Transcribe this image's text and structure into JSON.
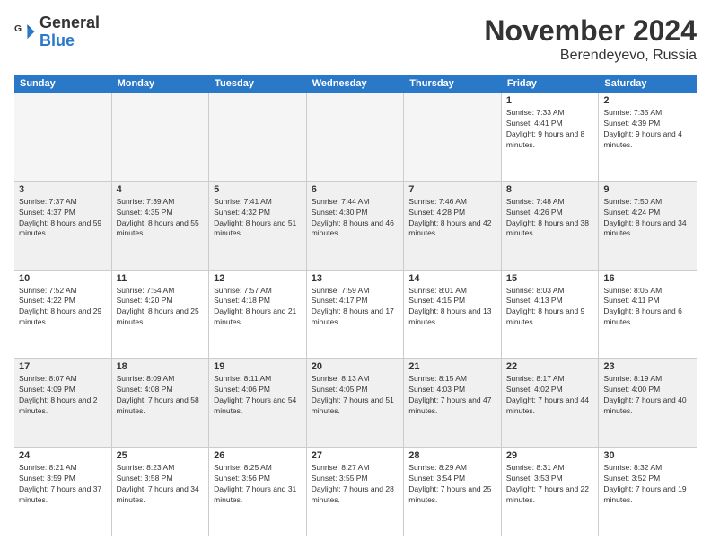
{
  "logo": {
    "general": "General",
    "blue": "Blue"
  },
  "title": "November 2024",
  "subtitle": "Berendeyevo, Russia",
  "days": [
    "Sunday",
    "Monday",
    "Tuesday",
    "Wednesday",
    "Thursday",
    "Friday",
    "Saturday"
  ],
  "weeks": [
    [
      {
        "day": "",
        "empty": true
      },
      {
        "day": "",
        "empty": true
      },
      {
        "day": "",
        "empty": true
      },
      {
        "day": "",
        "empty": true
      },
      {
        "day": "",
        "empty": true
      },
      {
        "day": "1",
        "sunrise": "7:33 AM",
        "sunset": "4:41 PM",
        "daylight": "9 hours and 8 minutes."
      },
      {
        "day": "2",
        "sunrise": "7:35 AM",
        "sunset": "4:39 PM",
        "daylight": "9 hours and 4 minutes."
      }
    ],
    [
      {
        "day": "3",
        "sunrise": "7:37 AM",
        "sunset": "4:37 PM",
        "daylight": "8 hours and 59 minutes."
      },
      {
        "day": "4",
        "sunrise": "7:39 AM",
        "sunset": "4:35 PM",
        "daylight": "8 hours and 55 minutes."
      },
      {
        "day": "5",
        "sunrise": "7:41 AM",
        "sunset": "4:32 PM",
        "daylight": "8 hours and 51 minutes."
      },
      {
        "day": "6",
        "sunrise": "7:44 AM",
        "sunset": "4:30 PM",
        "daylight": "8 hours and 46 minutes."
      },
      {
        "day": "7",
        "sunrise": "7:46 AM",
        "sunset": "4:28 PM",
        "daylight": "8 hours and 42 minutes."
      },
      {
        "day": "8",
        "sunrise": "7:48 AM",
        "sunset": "4:26 PM",
        "daylight": "8 hours and 38 minutes."
      },
      {
        "day": "9",
        "sunrise": "7:50 AM",
        "sunset": "4:24 PM",
        "daylight": "8 hours and 34 minutes."
      }
    ],
    [
      {
        "day": "10",
        "sunrise": "7:52 AM",
        "sunset": "4:22 PM",
        "daylight": "8 hours and 29 minutes."
      },
      {
        "day": "11",
        "sunrise": "7:54 AM",
        "sunset": "4:20 PM",
        "daylight": "8 hours and 25 minutes."
      },
      {
        "day": "12",
        "sunrise": "7:57 AM",
        "sunset": "4:18 PM",
        "daylight": "8 hours and 21 minutes."
      },
      {
        "day": "13",
        "sunrise": "7:59 AM",
        "sunset": "4:17 PM",
        "daylight": "8 hours and 17 minutes."
      },
      {
        "day": "14",
        "sunrise": "8:01 AM",
        "sunset": "4:15 PM",
        "daylight": "8 hours and 13 minutes."
      },
      {
        "day": "15",
        "sunrise": "8:03 AM",
        "sunset": "4:13 PM",
        "daylight": "8 hours and 9 minutes."
      },
      {
        "day": "16",
        "sunrise": "8:05 AM",
        "sunset": "4:11 PM",
        "daylight": "8 hours and 6 minutes."
      }
    ],
    [
      {
        "day": "17",
        "sunrise": "8:07 AM",
        "sunset": "4:09 PM",
        "daylight": "8 hours and 2 minutes."
      },
      {
        "day": "18",
        "sunrise": "8:09 AM",
        "sunset": "4:08 PM",
        "daylight": "7 hours and 58 minutes."
      },
      {
        "day": "19",
        "sunrise": "8:11 AM",
        "sunset": "4:06 PM",
        "daylight": "7 hours and 54 minutes."
      },
      {
        "day": "20",
        "sunrise": "8:13 AM",
        "sunset": "4:05 PM",
        "daylight": "7 hours and 51 minutes."
      },
      {
        "day": "21",
        "sunrise": "8:15 AM",
        "sunset": "4:03 PM",
        "daylight": "7 hours and 47 minutes."
      },
      {
        "day": "22",
        "sunrise": "8:17 AM",
        "sunset": "4:02 PM",
        "daylight": "7 hours and 44 minutes."
      },
      {
        "day": "23",
        "sunrise": "8:19 AM",
        "sunset": "4:00 PM",
        "daylight": "7 hours and 40 minutes."
      }
    ],
    [
      {
        "day": "24",
        "sunrise": "8:21 AM",
        "sunset": "3:59 PM",
        "daylight": "7 hours and 37 minutes."
      },
      {
        "day": "25",
        "sunrise": "8:23 AM",
        "sunset": "3:58 PM",
        "daylight": "7 hours and 34 minutes."
      },
      {
        "day": "26",
        "sunrise": "8:25 AM",
        "sunset": "3:56 PM",
        "daylight": "7 hours and 31 minutes."
      },
      {
        "day": "27",
        "sunrise": "8:27 AM",
        "sunset": "3:55 PM",
        "daylight": "7 hours and 28 minutes."
      },
      {
        "day": "28",
        "sunrise": "8:29 AM",
        "sunset": "3:54 PM",
        "daylight": "7 hours and 25 minutes."
      },
      {
        "day": "29",
        "sunrise": "8:31 AM",
        "sunset": "3:53 PM",
        "daylight": "7 hours and 22 minutes."
      },
      {
        "day": "30",
        "sunrise": "8:32 AM",
        "sunset": "3:52 PM",
        "daylight": "7 hours and 19 minutes."
      }
    ]
  ]
}
